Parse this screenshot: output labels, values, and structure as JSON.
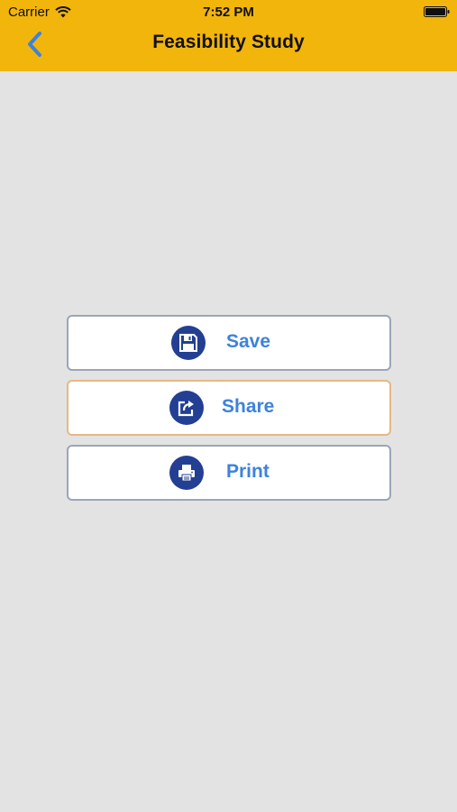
{
  "status_bar": {
    "carrier": "Carrier",
    "time": "7:52 PM"
  },
  "nav": {
    "title": "Feasibility Study",
    "back_icon": "chevron-left-icon"
  },
  "actions": [
    {
      "label": "Save",
      "icon": "floppy-disk-icon"
    },
    {
      "label": "Share",
      "icon": "share-icon"
    },
    {
      "label": "Print",
      "icon": "printer-icon"
    }
  ],
  "colors": {
    "header": "#f2b50c",
    "background": "#e3e3e3",
    "accent": "#3d82dc",
    "icon_circle": "#233f93"
  }
}
